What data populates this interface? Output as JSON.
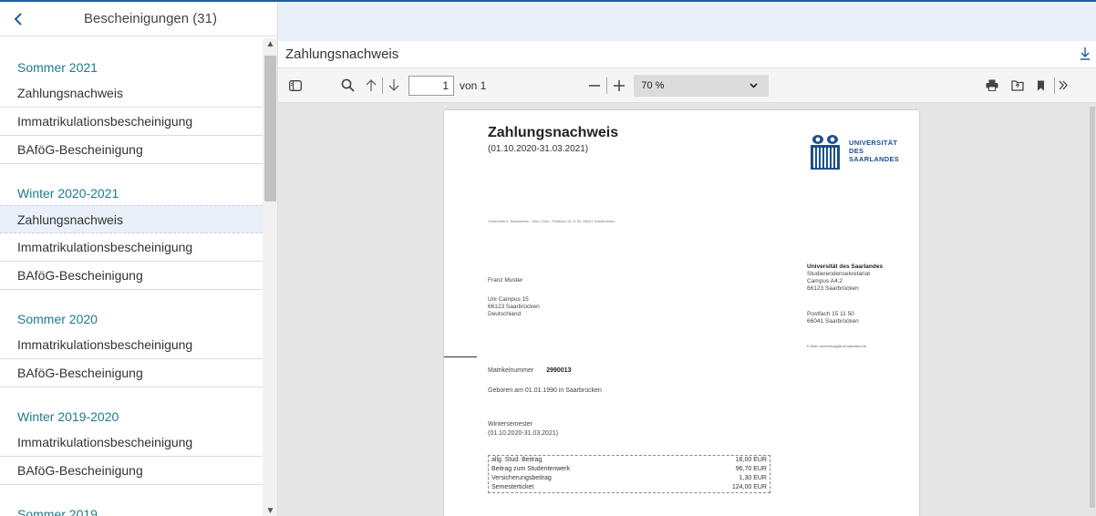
{
  "sidebar": {
    "back_label": "<",
    "title": "Bescheinigungen (31)",
    "sections": [
      {
        "title": "Sommer 2021",
        "items": [
          "Zahlungsnachweis",
          "Immatrikulationsbescheinigung",
          "BAföG-Bescheinigung"
        ]
      },
      {
        "title": "Winter 2020-2021",
        "items": [
          "Zahlungsnachweis",
          "Immatrikulationsbescheinigung",
          "BAföG-Bescheinigung"
        ]
      },
      {
        "title": "Sommer 2020",
        "items": [
          "Immatrikulationsbescheinigung",
          "BAföG-Bescheinigung"
        ]
      },
      {
        "title": "Winter 2019-2020",
        "items": [
          "Immatrikulationsbescheinigung",
          "BAföG-Bescheinigung"
        ]
      },
      {
        "title": "Sommer 2019",
        "items": []
      }
    ],
    "selected": "Winter 2020-2021 / Zahlungsnachweis"
  },
  "document": {
    "title": "Zahlungsnachweis",
    "download_icon": "download-icon"
  },
  "toolbar": {
    "page_value": "1",
    "page_of": "von 1",
    "zoom_label": "70 %"
  },
  "pdf": {
    "title": "Zahlungsnachweis",
    "range": "(01.10.2020-31.03.2021)",
    "logo_lines": [
      "UNIVERSITÄT",
      "DES",
      "SAARLANDES"
    ],
    "sender_line": "Universität d. Saarlandes - Stud.-Sekr., Postfach 15 11 50, 66041 Saarbrücken",
    "recipient_name": "Franz Muster",
    "recipient_address": [
      "Uni Campus  15",
      "66123   Saarbrücken",
      "Deutschland"
    ],
    "uni_name": "Universität des Saarlandes",
    "uni_address": [
      "Studierendensekretariat",
      "Campus A4.2",
      "66123 Saarbrücken"
    ],
    "uni_postbox": [
      "Postfach 15 11 50",
      "66041 Saarbrücken"
    ],
    "uni_email": "E-Mail: anmeldung@uni-saarland.de",
    "matrikel_label": "Matrikelnummer",
    "matrikel_value": "2990013",
    "born": "Geboren am 01.01.1990   in Saarbrücken",
    "semester_label": "Wintersemester",
    "semester_range": "(01.10.2020-31.03.2021)",
    "fees": [
      {
        "label": "allg. Stud. Beitrag",
        "amount": "16,00  EUR"
      },
      {
        "label": "Beitrag zum Studentenwerk",
        "amount": "96,70  EUR"
      },
      {
        "label": "Versicherungsbeitrag",
        "amount": "1,30  EUR"
      },
      {
        "label": "Semesterticket",
        "amount": "124,00  EUR"
      }
    ]
  },
  "colors": {
    "accent": "#1f5f9e",
    "section_title": "#1c7c8c",
    "selected_bg": "#e9f0f9"
  }
}
